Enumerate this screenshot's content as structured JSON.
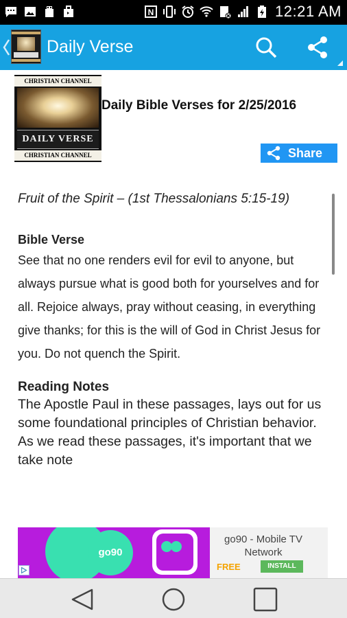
{
  "status_bar": {
    "time": "12:21 AM",
    "icons": [
      "chat-icon",
      "image-icon",
      "usb-icon",
      "bag-icon",
      "nfc-icon",
      "vibrate-icon",
      "alarm-icon",
      "wifi-icon",
      "data-icon",
      "signal-icon",
      "battery-icon"
    ]
  },
  "app_bar": {
    "title": "Daily Verse",
    "actions": [
      "search-icon",
      "share-icon"
    ]
  },
  "header": {
    "cover_top_text": "CHRISTIAN CHANNEL",
    "cover_title": "DAILY VERSE",
    "cover_bottom_text": "CHRISTIAN CHANNEL",
    "daily_title": "Daily Bible Verses for 2/25/2016",
    "share_label": "Share"
  },
  "content": {
    "verse_title": "Fruit of the Spirit – (1st Thessalonians 5:15-19)",
    "bible_verse_heading": "Bible Verse",
    "bible_verse_text": "See that no one renders evil for evil to anyone, but always pursue what is good both for yourselves and for all. Rejoice always, pray without ceasing, in everything give thanks; for this is the will of God in Christ Jesus for you. Do not quench the Spirit.",
    "notes_heading": "Reading Notes",
    "notes_text": "The Apostle Paul in these passages, lays out for us some foundational principles of Christian behavior. As we read these passages, it's important that we take note"
  },
  "ad": {
    "graphic_text": "go90",
    "app_name": "go90 - Mobile TV Network",
    "price": "FREE",
    "install_label": "INSTALL"
  },
  "nav_bar": {
    "buttons": [
      "back-icon",
      "home-icon",
      "recents-icon"
    ]
  },
  "colors": {
    "app_bar": "#17a2e1",
    "share_button": "#2196f3",
    "ad_purple": "#b71cdd",
    "ad_green": "#39e0b0",
    "install_green": "#5cb85c",
    "free_orange": "#f4a300"
  }
}
